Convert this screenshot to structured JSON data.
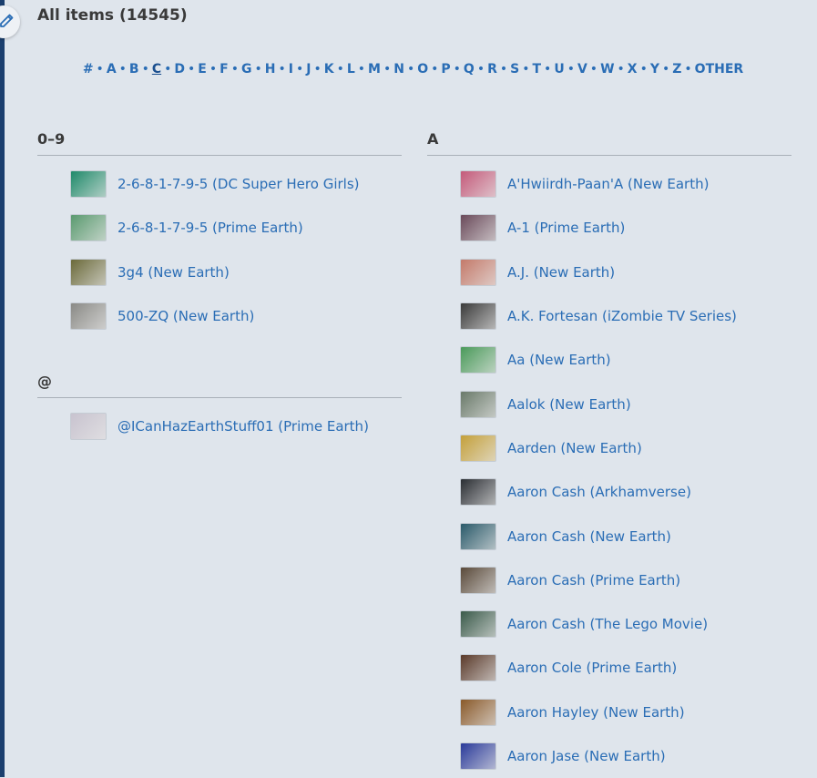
{
  "page": {
    "title": "All items (14545)"
  },
  "alpha_nav": {
    "letters": [
      "#",
      "A",
      "B",
      "C",
      "D",
      "E",
      "F",
      "G",
      "H",
      "I",
      "J",
      "K",
      "L",
      "M",
      "N",
      "O",
      "P",
      "Q",
      "R",
      "S",
      "T",
      "U",
      "V",
      "W",
      "X",
      "Y",
      "Z",
      "OTHER"
    ],
    "current": "C"
  },
  "sections": [
    {
      "heading": "0–9",
      "items": [
        {
          "label": "2-6-8-1-7-9-5 (DC Super Hero Girls)",
          "color": "#1f8a6a"
        },
        {
          "label": "2-6-8-1-7-9-5 (Prime Earth)",
          "color": "#5a9a6f"
        },
        {
          "label": "3g4 (New Earth)",
          "color": "#6b6a3a"
        },
        {
          "label": "500-ZQ (New Earth)",
          "color": "#8a8a86"
        }
      ]
    },
    {
      "heading": "@",
      "items": [
        {
          "label": "@ICanHazEarthStuff01 (Prime Earth)",
          "color": "#c8c3cf"
        }
      ]
    },
    {
      "heading": "A",
      "items": [
        {
          "label": "A'Hwiirdh-Paan'A (New Earth)",
          "color": "#c45a7a"
        },
        {
          "label": "A-1 (Prime Earth)",
          "color": "#6a4a5a"
        },
        {
          "label": "A.J. (New Earth)",
          "color": "#c47a6a"
        },
        {
          "label": "A.K. Fortesan (iZombie TV Series)",
          "color": "#3a3a3a"
        },
        {
          "label": "Aa (New Earth)",
          "color": "#4a9a5a"
        },
        {
          "label": "Aalok (New Earth)",
          "color": "#6a7a6a"
        },
        {
          "label": "Aarden (New Earth)",
          "color": "#c4a03a"
        },
        {
          "label": "Aaron Cash (Arkhamverse)",
          "color": "#2a2e33"
        },
        {
          "label": "Aaron Cash (New Earth)",
          "color": "#2a5a6a"
        },
        {
          "label": "Aaron Cash (Prime Earth)",
          "color": "#5a4a3a"
        },
        {
          "label": "Aaron Cash (The Lego Movie)",
          "color": "#3a5a4a"
        },
        {
          "label": "Aaron Cole (Prime Earth)",
          "color": "#5a3a2a"
        },
        {
          "label": "Aaron Hayley (New Earth)",
          "color": "#8a5a2a"
        },
        {
          "label": "Aaron Jase (New Earth)",
          "color": "#2a3a9a"
        }
      ]
    }
  ]
}
